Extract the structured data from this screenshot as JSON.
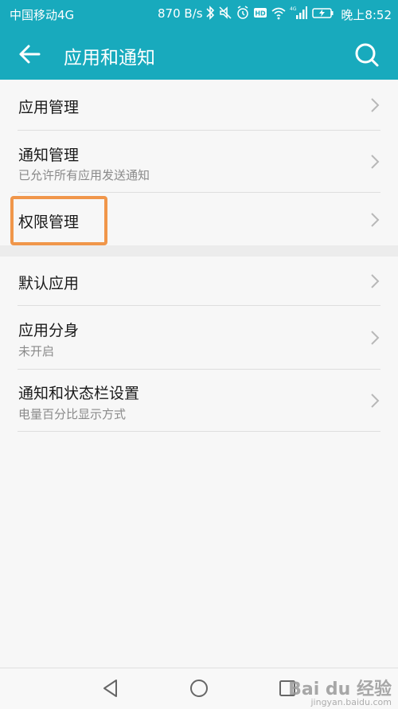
{
  "status_bar": {
    "carrier": "中国移动4G",
    "network_speed": "870 B/s",
    "icons": [
      "bluetooth-icon",
      "mute-icon",
      "alarm-icon",
      "hd-icon",
      "wifi-icon",
      "signal-icon",
      "battery-charging-icon"
    ],
    "time": "晚上8:52"
  },
  "toolbar": {
    "title": "应用和通知",
    "back_icon": "back-arrow-icon",
    "search_icon": "search-icon"
  },
  "colors": {
    "accent": "#18aabd",
    "highlight_box": "#f0964a"
  },
  "section_one": [
    {
      "title": "应用管理",
      "subtitle": ""
    },
    {
      "title": "通知管理",
      "subtitle": "已允许所有应用发送通知"
    },
    {
      "title": "权限管理",
      "subtitle": ""
    }
  ],
  "section_two": [
    {
      "title": "默认应用",
      "subtitle": ""
    },
    {
      "title": "应用分身",
      "subtitle": "未开启"
    },
    {
      "title": "通知和状态栏设置",
      "subtitle": "电量百分比显示方式"
    }
  ],
  "nav_bar": {
    "buttons": [
      "back-triangle-icon",
      "home-circle-icon",
      "recents-square-icon"
    ]
  },
  "watermark": {
    "text": "Bai du 经验",
    "sub": "jingyan.baidu.com"
  }
}
